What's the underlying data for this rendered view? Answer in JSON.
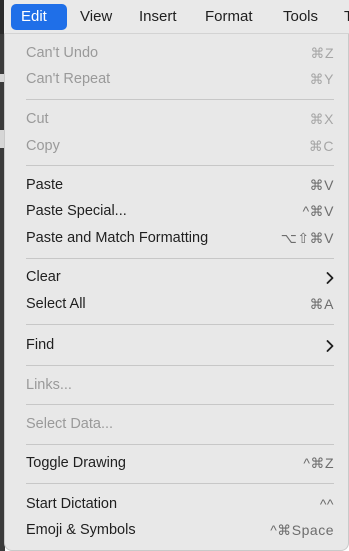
{
  "menubar": {
    "items": [
      "Edit",
      "View",
      "Insert",
      "Format",
      "Tools"
    ],
    "overflow": "T"
  },
  "menu": {
    "undo": {
      "label": "Can't Undo",
      "shortcut": "⌘Z"
    },
    "repeat": {
      "label": "Can't Repeat",
      "shortcut": "⌘Y"
    },
    "cut": {
      "label": "Cut",
      "shortcut": "⌘X"
    },
    "copy": {
      "label": "Copy",
      "shortcut": "⌘C"
    },
    "paste": {
      "label": "Paste",
      "shortcut": "⌘V"
    },
    "paste_special": {
      "label": "Paste Special...",
      "shortcut": "^⌘V"
    },
    "paste_match": {
      "label": "Paste and Match Formatting",
      "shortcut": "⌥⇧⌘V"
    },
    "clear": {
      "label": "Clear"
    },
    "select_all": {
      "label": "Select All",
      "shortcut": "⌘A"
    },
    "find": {
      "label": "Find"
    },
    "links": {
      "label": "Links..."
    },
    "select_data": {
      "label": "Select Data..."
    },
    "toggle_drawing": {
      "label": "Toggle Drawing",
      "shortcut": "^⌘Z"
    },
    "start_dictation": {
      "label": "Start Dictation",
      "shortcut": "^^"
    },
    "emoji": {
      "label": "Emoji & Symbols",
      "shortcut": "^⌘Space"
    }
  },
  "colors": {
    "accent": "#1f6fe8",
    "menu_background": "#e8e8e8",
    "disabled_text": "#9a9a9a"
  }
}
